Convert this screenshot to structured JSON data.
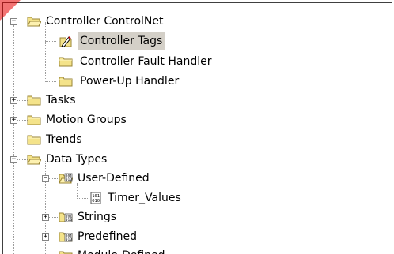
{
  "colors": {
    "folder_fill": "#f4e38a",
    "folder_stroke": "#9a8536",
    "selection": "#d4d0c8"
  },
  "tree": {
    "controller": {
      "label": "Controller ControlNet",
      "icon": "folder-open-icon",
      "expander": "−"
    },
    "controller_tags": {
      "label": "Controller Tags",
      "icon": "edit-tags-icon"
    },
    "controller_fault_handler": {
      "label": "Controller Fault Handler",
      "icon": "folder-icon"
    },
    "power_up_handler": {
      "label": "Power-Up Handler",
      "icon": "folder-icon"
    },
    "tasks": {
      "label": "Tasks",
      "icon": "folder-icon",
      "expander": "+"
    },
    "motion_groups": {
      "label": "Motion Groups",
      "icon": "folder-icon",
      "expander": "+"
    },
    "trends": {
      "label": "Trends",
      "icon": "folder-icon"
    },
    "data_types": {
      "label": "Data Types",
      "icon": "folder-open-icon",
      "expander": "−"
    },
    "user_defined": {
      "label": "User-Defined",
      "icon": "datatype-folder-open-icon",
      "expander": "−"
    },
    "timer_values": {
      "label": "Timer_Values",
      "icon": "datatype-icon"
    },
    "strings": {
      "label": "Strings",
      "icon": "datatype-folder-icon",
      "expander": "+"
    },
    "predefined": {
      "label": "Predefined",
      "icon": "datatype-folder-icon",
      "expander": "+"
    },
    "module_defined": {
      "label": "Module-Defined",
      "icon": "datatype-folder-icon"
    }
  }
}
